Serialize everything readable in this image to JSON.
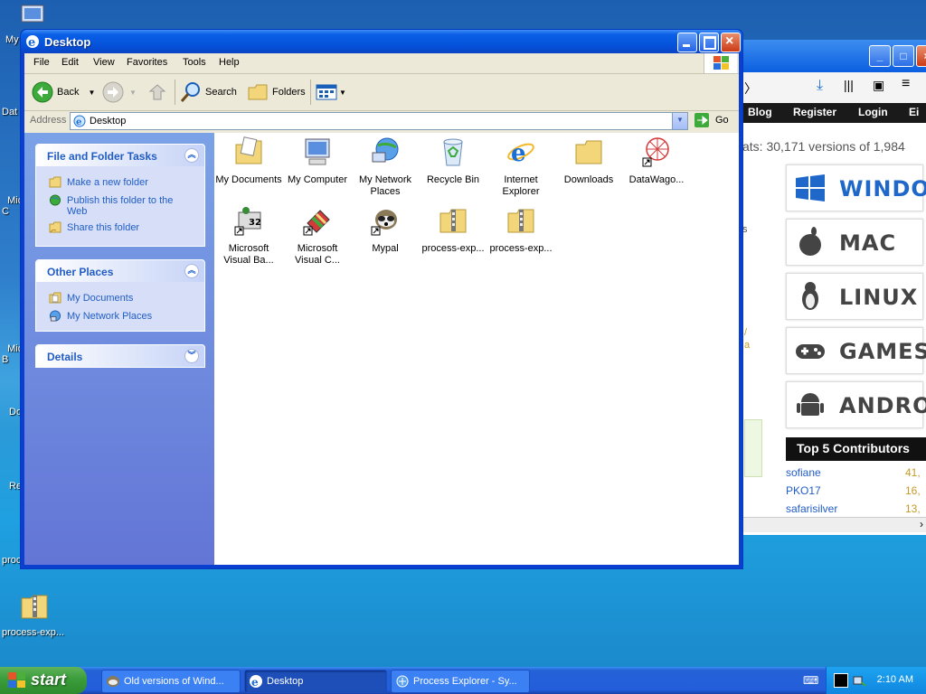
{
  "desktop": {
    "icons": [
      {
        "label": "My"
      },
      {
        "label": "Dat"
      },
      {
        "label": "Micro\nC"
      },
      {
        "label": "Micro\nB"
      },
      {
        "label": "Do"
      },
      {
        "label": "Re"
      },
      {
        "label": "proc"
      },
      {
        "label": "process-exp..."
      }
    ]
  },
  "browser": {
    "nav_links": [
      "Blog",
      "Register",
      "Login",
      "Ei"
    ],
    "stats_text": "ats: 30,171 versions of 1,984",
    "os_cards": [
      "WINDO",
      "MAC",
      "LINUX",
      "GAMES",
      "ANDROI"
    ],
    "contributors_title": "Top 5 Contributors",
    "contributors": [
      {
        "name": "sofiane",
        "count": "41,"
      },
      {
        "name": "PKO17",
        "count": "16,"
      },
      {
        "name": "safarisilver",
        "count": "13,"
      }
    ],
    "side_fragments": [
      "s",
      "/",
      "a"
    ]
  },
  "explorer": {
    "title": "Desktop",
    "menu": [
      "File",
      "Edit",
      "View",
      "Favorites",
      "Tools",
      "Help"
    ],
    "toolbar": {
      "back": "Back",
      "search": "Search",
      "folders": "Folders"
    },
    "address": {
      "label": "Address",
      "value": "Desktop",
      "go": "Go"
    },
    "tasks": {
      "file_folder_title": "File and Folder Tasks",
      "file_folder_links": [
        "Make a new folder",
        "Publish this folder to the Web",
        "Share this folder"
      ],
      "other_places_title": "Other Places",
      "other_places_links": [
        "My Documents",
        "My Network Places"
      ],
      "details_title": "Details"
    },
    "files": [
      {
        "label": "My Documents",
        "icon": "folder-documents-icon"
      },
      {
        "label": "My Computer",
        "icon": "computer-icon"
      },
      {
        "label": "My Network Places",
        "icon": "network-icon"
      },
      {
        "label": "Recycle Bin",
        "icon": "recycle-bin-icon"
      },
      {
        "label": "Internet Explorer",
        "icon": "ie-icon"
      },
      {
        "label": "Downloads",
        "icon": "folder-icon"
      },
      {
        "label": "DataWago...",
        "icon": "datawago-icon"
      },
      {
        "label": "Microsoft Visual Ba...",
        "icon": "vb-icon"
      },
      {
        "label": "Microsoft Visual C...",
        "icon": "vc-icon"
      },
      {
        "label": "Mypal",
        "icon": "mypal-icon"
      },
      {
        "label": "process-exp...",
        "icon": "zip-folder-icon"
      },
      {
        "label": "process-exp...",
        "icon": "zip-folder-icon"
      }
    ]
  },
  "taskbar": {
    "start": "start",
    "buttons": [
      {
        "label": "Old versions of Wind..."
      },
      {
        "label": "Desktop"
      },
      {
        "label": "Process Explorer - Sy..."
      }
    ],
    "clock": "2:10 AM"
  },
  "colors": {
    "xp_blue": "#0a5fe6",
    "taskpane_link": "#215dc6",
    "start_green": "#3a9c3a"
  }
}
